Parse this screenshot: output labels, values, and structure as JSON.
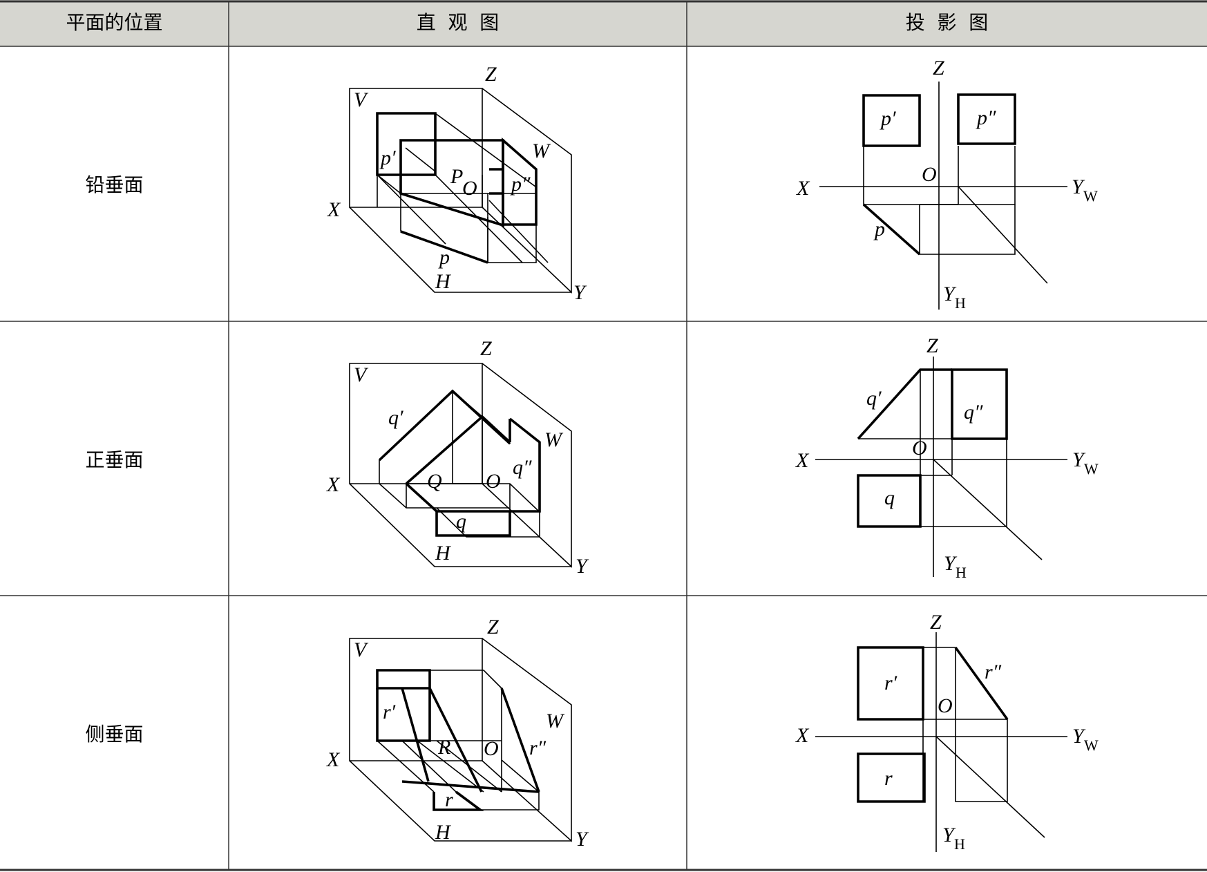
{
  "header": {
    "col1": "平面的位置",
    "col2": "直  观  图",
    "col3": "投  影  图"
  },
  "rows": [
    {
      "name": "铅垂面",
      "iso": {
        "V": "V",
        "Z": "Z",
        "W": "W",
        "X": "X",
        "Y": "Y",
        "H": "H",
        "O": "O",
        "plane": "P",
        "front": "p′",
        "side": "p″",
        "top": "p"
      },
      "proj": {
        "Z": "Z",
        "X": "X",
        "O": "O",
        "YW": "Y",
        "YW_sub": "W",
        "YH": "Y",
        "YH_sub": "H",
        "front": "p′",
        "side": "p″",
        "top": "p"
      }
    },
    {
      "name": "正垂面",
      "iso": {
        "V": "V",
        "Z": "Z",
        "W": "W",
        "X": "X",
        "Y": "Y",
        "H": "H",
        "O": "O",
        "plane": "Q",
        "front": "q′",
        "side": "q″",
        "top": "q"
      },
      "proj": {
        "Z": "Z",
        "X": "X",
        "O": "O",
        "YW": "Y",
        "YW_sub": "W",
        "YH": "Y",
        "YH_sub": "H",
        "front": "q′",
        "side": "q″",
        "top": "q"
      }
    },
    {
      "name": "侧垂面",
      "iso": {
        "V": "V",
        "Z": "Z",
        "W": "W",
        "X": "X",
        "Y": "Y",
        "H": "H",
        "O": "O",
        "plane": "R",
        "front": "r′",
        "side": "r″",
        "top": "r"
      },
      "proj": {
        "Z": "Z",
        "X": "X",
        "O": "O",
        "YW": "Y",
        "YW_sub": "W",
        "YH": "Y",
        "YH_sub": "H",
        "front": "r′",
        "side": "r″",
        "top": "r"
      }
    }
  ],
  "colors": {
    "header_bg": "#d6d6d0",
    "rule": "#333333"
  }
}
